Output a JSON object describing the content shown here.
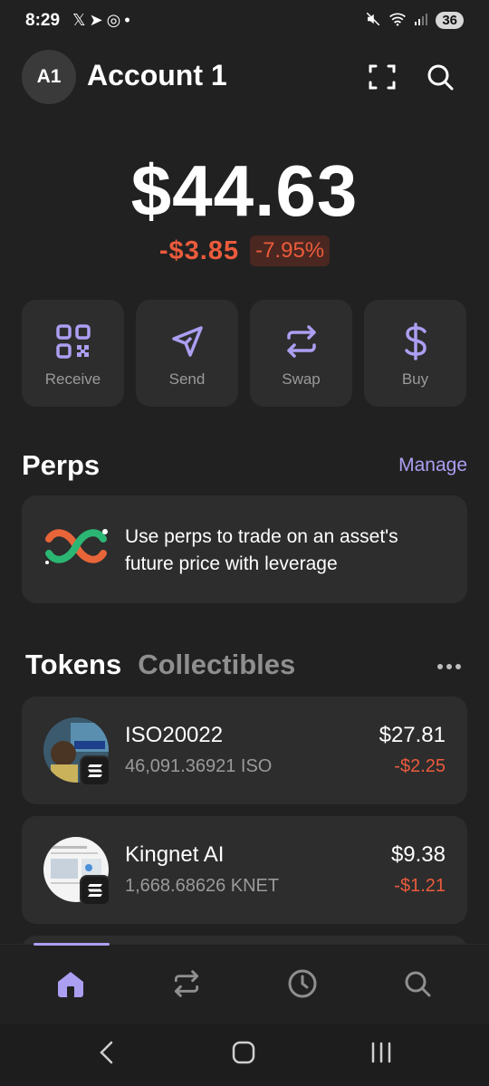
{
  "status_bar": {
    "time": "8:29",
    "left_icons": [
      "x-icon",
      "telegram-icon",
      "whatsapp-icon",
      "dot"
    ],
    "battery": "36"
  },
  "header": {
    "avatar_text": "A1",
    "account_name": "Account 1"
  },
  "balance": {
    "amount": "$44.63",
    "change_abs": "-$3.85",
    "change_pct": "-7.95%"
  },
  "actions": [
    {
      "label": "Receive",
      "icon": "qr-code-icon"
    },
    {
      "label": "Send",
      "icon": "send-icon"
    },
    {
      "label": "Swap",
      "icon": "swap-icon"
    },
    {
      "label": "Buy",
      "icon": "dollar-icon"
    }
  ],
  "perps": {
    "title": "Perps",
    "manage": "Manage",
    "description": "Use perps to trade on an asset's future price with leverage"
  },
  "tabs": {
    "tokens": "Tokens",
    "collectibles": "Collectibles"
  },
  "tokens": [
    {
      "name": "ISO20022",
      "amount": "46,091.36921 ISO",
      "value": "$27.81",
      "change": "-$2.25"
    },
    {
      "name": "Kingnet AI",
      "amount": "1,668.68626 KNET",
      "value": "$9.38",
      "change": "-$1.21"
    }
  ],
  "colors": {
    "background": "#212121",
    "card": "#2d2d2d",
    "accent": "#ab9ff2",
    "negative": "#eb5b3c"
  }
}
